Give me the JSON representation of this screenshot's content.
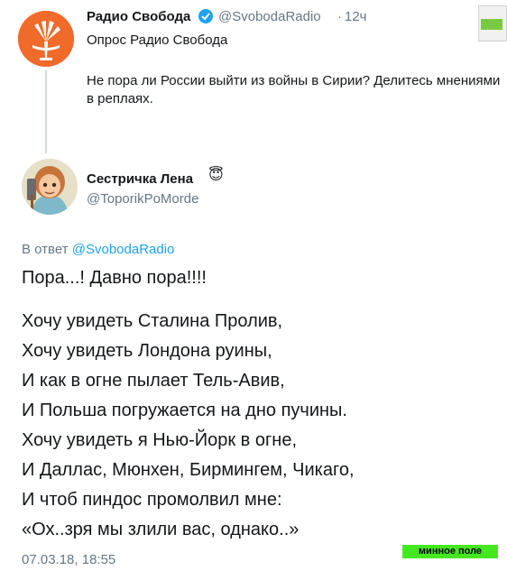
{
  "parent_tweet": {
    "display_name": "Радио Свобода",
    "handle": "@SvobodaRadio",
    "separator": "·",
    "time": "12ч",
    "line1": "Опрос Радио Свобода",
    "line2": "Не пора ли России выйти из войны в Сирии? Делитесь мнениями в реплаях.",
    "avatar_icon": "radio-svoboda-logo-icon",
    "verified_icon": "verified-badge-icon"
  },
  "reply_tweet": {
    "display_name": "Сестричка Лена",
    "name_emoji": "😇",
    "handle": "@ToporikPoMorde",
    "replying_prefix": "В ответ",
    "replying_mention": "@SvobodaRadio",
    "first_line": "Пора...! Давно пора!!!!",
    "poem": [
      "Хочу увидеть Сталина Пролив,",
      "Хочу увидеть Лондона руины,",
      "И как в огне пылает Тель-Авив,",
      "И Польша погружается на дно пучины.",
      "Хочу увидеть я Нью-Йорк в огне,",
      "И Даллас, Мюнхен, Бирмингем, Чикаго,",
      "И чтоб пиндос промолвил мне:",
      "«Ох..зря мы злили вас, однако..»"
    ],
    "timestamp": "07.03.18, 18:55"
  },
  "watermark": {
    "label": "минное поле"
  },
  "colors": {
    "link": "#1da1f2",
    "secondary_text": "#657786",
    "avatar_orange": "#f06a2a",
    "watermark_green": "#45e81f"
  }
}
